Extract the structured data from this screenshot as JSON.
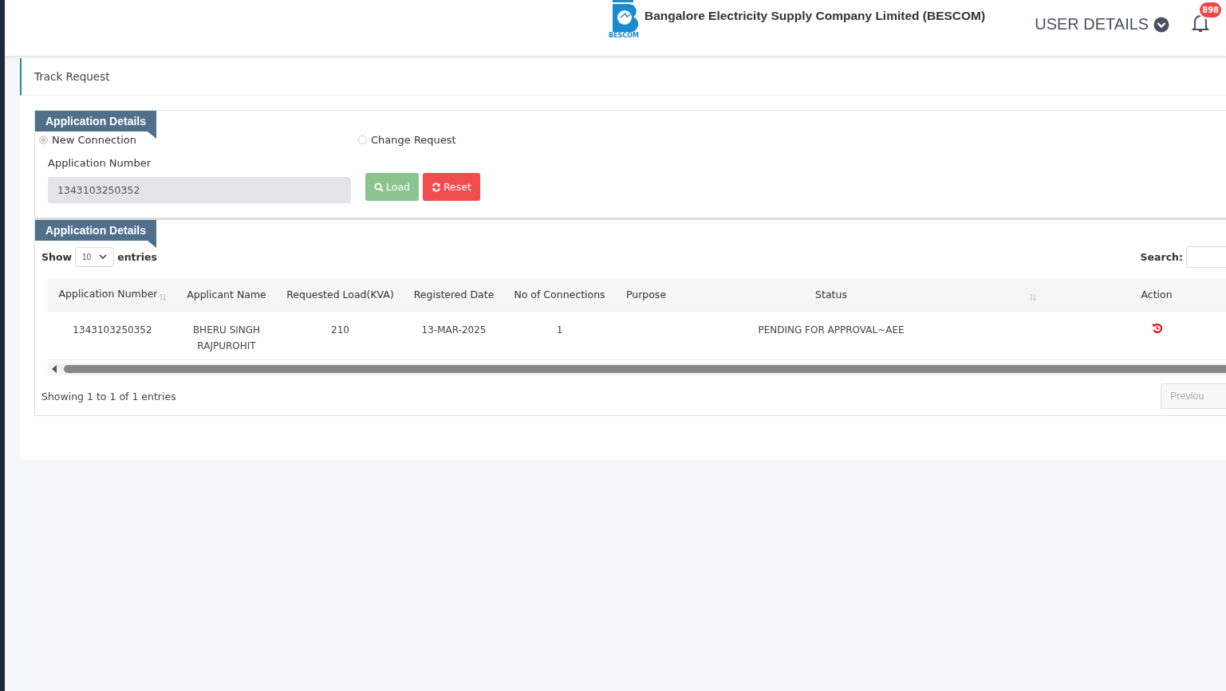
{
  "header": {
    "logo_caption": "BESCOM",
    "company": "Bangalore Electricity Supply Company Limited (BESCOM)",
    "user_menu": "USER DETAILS",
    "notifications": "898"
  },
  "page_title": "Track Request",
  "form": {
    "section_title": "Application Details",
    "options": [
      {
        "label": "New Connection",
        "selected": true
      },
      {
        "label": "Change Request",
        "selected": false
      }
    ],
    "field_label": "Application Number",
    "field_value": "1343103250352",
    "buttons": [
      {
        "kind": "load",
        "label": "Load"
      },
      {
        "kind": "reset",
        "label": "Reset"
      }
    ]
  },
  "results": {
    "section_title": "Application Details",
    "show_label": "Show",
    "page_size": "10",
    "entries_label": "entries",
    "search_label": "Search:",
    "columns": [
      {
        "label": "Application Number",
        "sortable": true
      },
      {
        "label": "Applicant Name",
        "sortable": false
      },
      {
        "label": "Requested Load(KVA)",
        "sortable": false
      },
      {
        "label": "Registered Date",
        "sortable": false
      },
      {
        "label": "No of Connections",
        "sortable": false
      },
      {
        "label": "Purpose",
        "sortable": false
      },
      {
        "label": "Status",
        "sortable": false
      },
      {
        "sortable": true
      },
      {
        "label": "Action",
        "sortable": false
      }
    ],
    "rows": [
      {
        "cells": [
          "1343103250352",
          "BHERU SINGH RAJPUROHIT",
          "210",
          "13-MAR-2025",
          "1",
          "",
          "PENDING FOR APPROVAL~AEE",
          ""
        ]
      }
    ],
    "info": "Showing 1 to 1 of 1 entries",
    "previous": "Previou"
  }
}
